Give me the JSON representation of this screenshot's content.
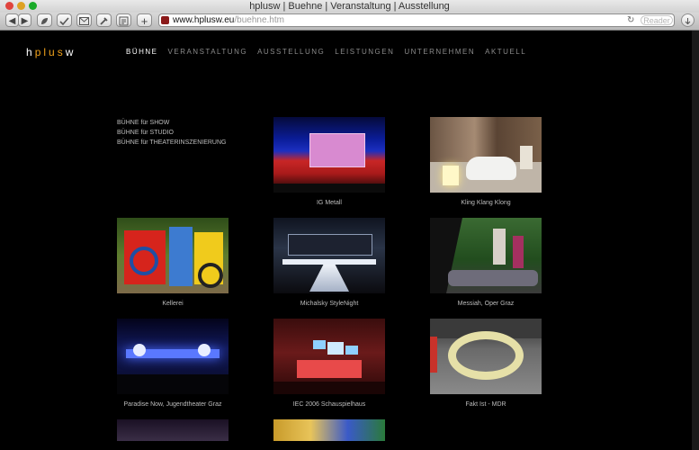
{
  "window": {
    "title": "hplusw | Buehne | Veranstaltung | Ausstellung"
  },
  "toolbar": {
    "back_label": "◀",
    "forward_label": "▶",
    "url_host": "www.hplusw.eu",
    "url_path": "/buehne.htm",
    "reload_label": "↻",
    "reader_label": "Reader"
  },
  "site": {
    "logo_parts": [
      "h",
      "p",
      "l",
      "u",
      "s",
      "w"
    ],
    "nav": [
      "BÜHNE",
      "VERANSTALTUNG",
      "AUSSTELLUNG",
      "LEISTUNGEN",
      "UNTERNEHMEN",
      "AKTUELL"
    ],
    "subnav": [
      "BÜHNE für SHOW",
      "BÜHNE für STUDIO",
      "BÜHNE für THEATERINSZENIERUNG"
    ],
    "gallery": [
      {
        "caption": "IG Metall",
        "icon": "stage-concert-photo"
      },
      {
        "caption": "Kling Klang Klong",
        "icon": "bathtub-room-photo"
      },
      {
        "caption": "Kellerei",
        "icon": "colorful-sculpture-photo"
      },
      {
        "caption": "Michalsky StyleNight",
        "icon": "runway-stage-photo"
      },
      {
        "caption": "Messiah, Oper Graz",
        "icon": "opera-performers-photo"
      },
      {
        "caption": "Paradise Now, Jugendtheater Graz",
        "icon": "blue-light-stage-photo"
      },
      {
        "caption": "IEC 2006 Schauspielhaus",
        "icon": "theatre-hall-photo"
      },
      {
        "caption": "Fakt Ist - MDR",
        "icon": "tv-studio-ring-photo"
      }
    ]
  },
  "colors": {
    "accent": "#f2a31b",
    "nav_active": "#ffffff",
    "nav_inactive": "#8a8a8a"
  }
}
